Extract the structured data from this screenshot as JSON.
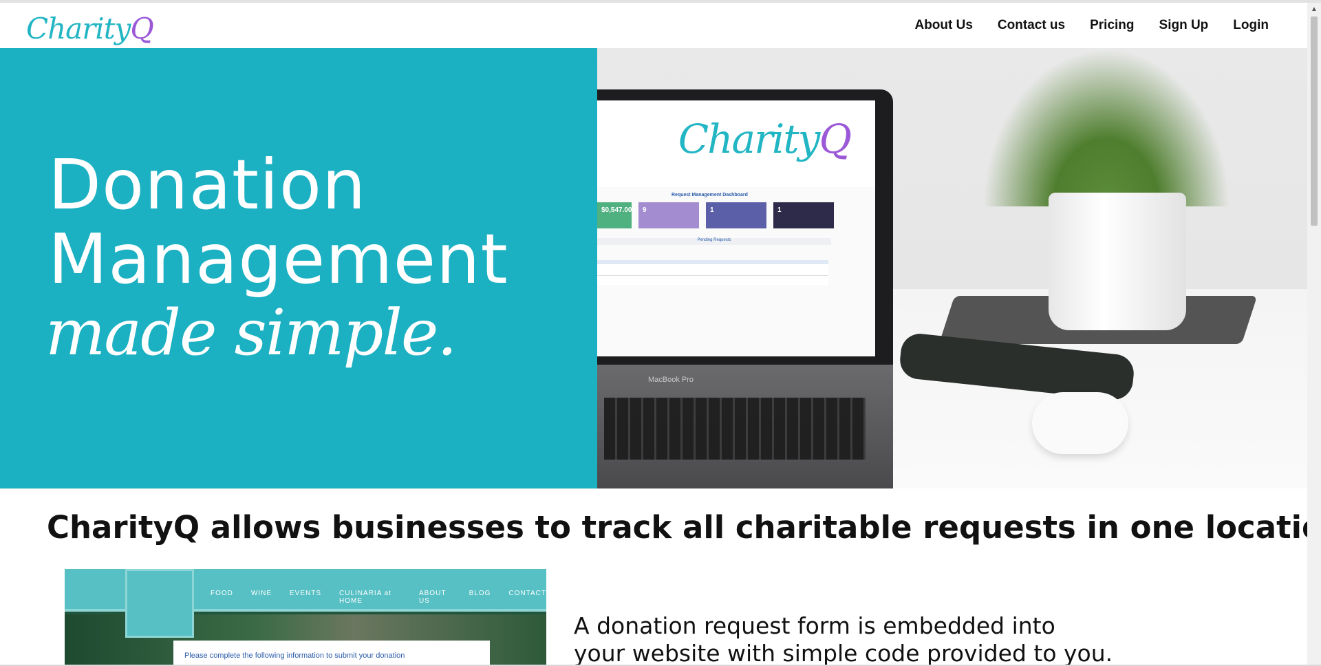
{
  "header": {
    "logo_part1": "Charity",
    "logo_part2": "Q",
    "nav": [
      "About Us",
      "Contact us",
      "Pricing",
      "Sign Up",
      "Login"
    ]
  },
  "hero": {
    "line1": "Donation",
    "line2": "Management",
    "line3": "made simple.",
    "bg_color": "#1bb0c2",
    "screen": {
      "logo_part1": "Charity",
      "logo_part2": "Q",
      "dashboard_title": "Request Management Dashboard",
      "cards": [
        "$0,547.00",
        "9",
        "1",
        "1"
      ],
      "pending_label": "Pending Requests",
      "laptop_label": "MacBook Pro"
    }
  },
  "tagline": "CharityQ allows businesses to track all charitable requests in one location.",
  "preview": {
    "nav": [
      "FOOD",
      "WINE",
      "EVENTS",
      "CULINARIA at HOME",
      "ABOUT US",
      "BLOG",
      "CONTACT"
    ],
    "card_text": "Please complete the following information to submit your donation"
  },
  "description": {
    "line1": "A donation request form is embedded into",
    "line2": "your website with simple code provided to you."
  },
  "colors": {
    "teal": "#22b5c4",
    "purple": "#9b59d8"
  }
}
